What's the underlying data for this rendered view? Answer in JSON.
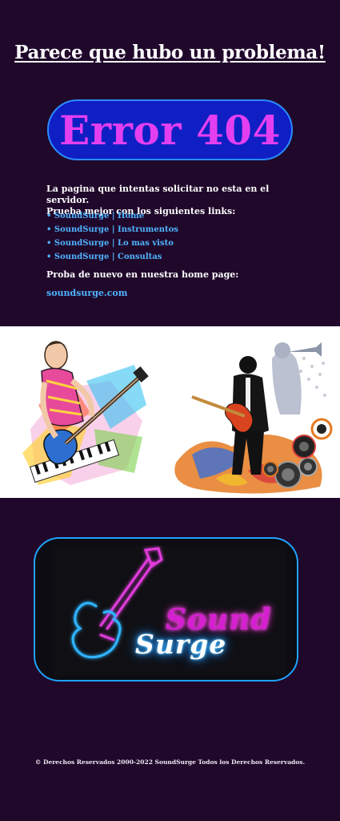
{
  "headline": "Parece que hubo un problema!",
  "error_code": "Error 404",
  "message": {
    "line1": "La pagina que intentas solicitar no esta en el servidor.",
    "line2": "Prueba mejor con los siguientes links:"
  },
  "links": [
    {
      "label": "• SoundSurge | Home"
    },
    {
      "label": "• SoundSurge | Instrumentos"
    },
    {
      "label": "• SoundSurge | Lo mas visto"
    },
    {
      "label": "• SoundSurge | Consultas"
    }
  ],
  "retry_text": "Proba de nuevo en nuestra home page:",
  "home_link": "soundsurge.com",
  "logo": {
    "word1": "Sound",
    "word2": "Surge"
  },
  "footer": "© Derechos Reservados 2000-2022  SoundSurge  Todos los Derechos Reservados.",
  "colors": {
    "background": "#20082b",
    "error_pill": "#0f1fc4",
    "error_text": "#e33ff0",
    "link": "#4fb4ff",
    "logo_border": "#1fa3ff",
    "neon_pink": "#d51fd0",
    "neon_blue": "#2aa8ff"
  },
  "images": {
    "left_art": "colorful-bass-guitarist-illustration",
    "right_art": "rock-guitarist-with-trumpet-and-speakers-illustration",
    "logo_guitar": "neon-electric-guitar-icon"
  }
}
